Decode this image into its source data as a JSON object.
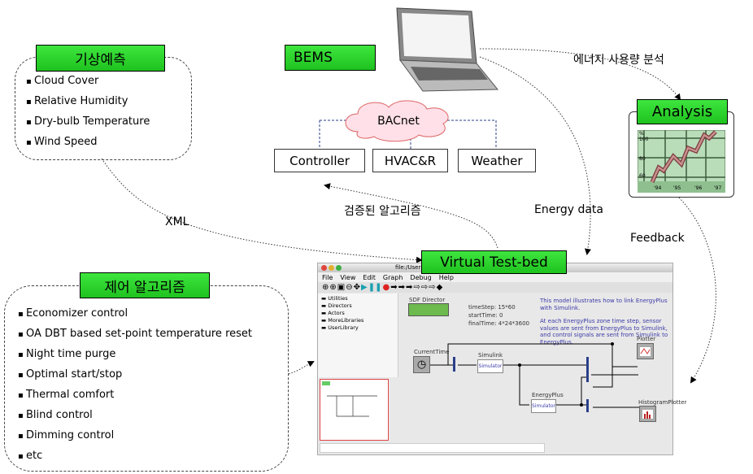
{
  "weather_forecast": {
    "title": "기상예측",
    "items": [
      "Cloud Cover",
      "Relative Humidity",
      "Dry-bulb Temperature",
      "Wind Speed"
    ]
  },
  "bems": {
    "title": "BEMS",
    "network": "BACnet",
    "devices": [
      "Controller",
      "HVAC&R",
      "Weather"
    ]
  },
  "labels": {
    "energy_analysis": "에너지 사용량 분석",
    "verified_algorithm": "검증된 알고리즘",
    "energy_data": "Energy data",
    "xml": "XML",
    "feedback": "Feedback"
  },
  "analysis": {
    "title": "Analysis",
    "chart": {
      "y_unit": "%",
      "y_ticks": [
        "100",
        "80",
        "60"
      ],
      "x_ticks": [
        "'94",
        "'95",
        "'96",
        "'97"
      ]
    }
  },
  "testbed": {
    "title": "Virtual Test-bed"
  },
  "control_algorithm": {
    "title": "제어 알고리즘",
    "items": [
      "Economizer control",
      "OA DBT based set-point temperature reset",
      "Night time purge",
      "Optimal start/stop",
      "Thermal comfort",
      "Blind control",
      "Dimming control",
      "etc"
    ]
  },
  "window": {
    "title": "file:/Users/.../system.xml",
    "menu": [
      "File",
      "View",
      "Edit",
      "Graph",
      "Debug",
      "Help"
    ],
    "library": [
      "Utilities",
      "Directors",
      "Actors",
      "MoreLibraries",
      "UserLibrary"
    ],
    "director": "SDF Director",
    "params": [
      "timeStep: 15*60",
      "startTime: 0",
      "finalTime: 4*24*3600"
    ],
    "description1": "This model illustrates how to link EnergyPlus with Simulink.",
    "description2": "At each EnergyPlus zone time step, sensor values are sent from EnergyPlus to Simulink, and control signals are sent from Simulink to EnergyPlus.",
    "actors": {
      "current_time": "CurrentTime",
      "simulink": "Simulink",
      "energyplus": "EnergyPlus",
      "simulator": "Simulator",
      "plotter": "Plotter",
      "histogram": "HistogramPlotter"
    }
  },
  "colors": {
    "label_green": "#22cc22",
    "chart_bg": "#b9dcb9",
    "note_blue": "#3a3aa8",
    "bus_blue": "#2a3f8a"
  }
}
